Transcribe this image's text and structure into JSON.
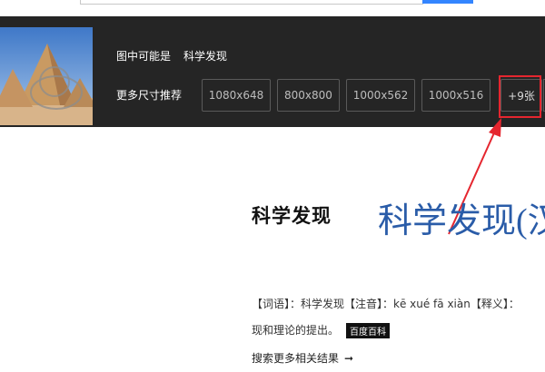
{
  "strip": {
    "guess_label": "图中可能是",
    "guess_value": "科学发现",
    "more_sizes_label": "更多尺寸推荐",
    "sizes": [
      "1080x648",
      "800x800",
      "1000x562",
      "1000x516"
    ],
    "more_count": "+9张"
  },
  "content": {
    "calligraphy": "科学发现",
    "title": "科学发现(汉",
    "definition_line1": "【词语】：科学发现【注音】：kē xué fā xiàn【释义】：",
    "definition_line2": "现和理论的提出。",
    "baike_badge": "百度百科",
    "more_results": "搜索更多相关结果",
    "more_results_arrow": "➞"
  },
  "colors": {
    "strip_bg": "#252525",
    "highlight": "#e5262f",
    "title_blue": "#2a5ca8"
  }
}
